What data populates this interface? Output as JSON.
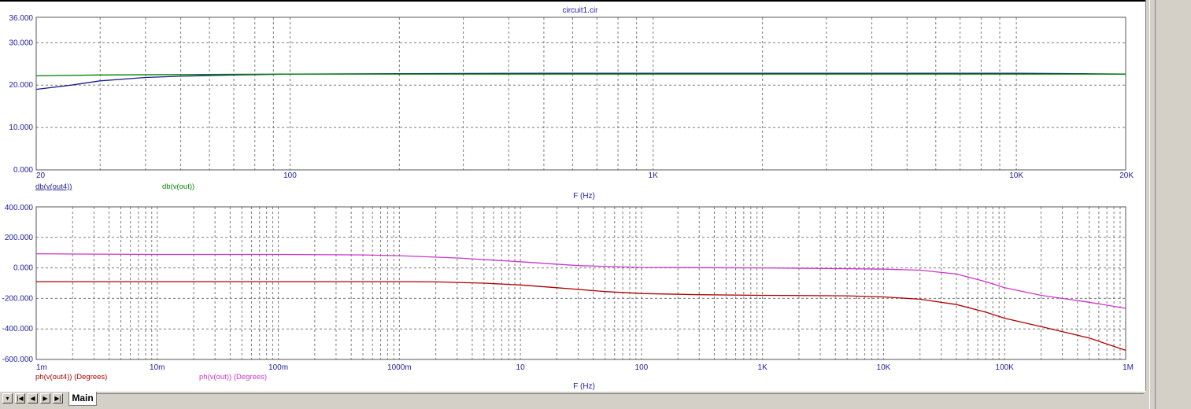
{
  "window_title": "circuit1.cir",
  "colors": {
    "grid": "#7a7a7a",
    "axis_text": "#2020a0",
    "db_out4": "#1c1c8c",
    "db_out": "#008000",
    "ph_out4": "#b00000",
    "ph_out": "#cc33cc"
  },
  "tabbar": {
    "buttons": [
      "chevron-down-icon",
      "first-icon",
      "prev-icon",
      "next-icon",
      "last-icon"
    ],
    "tab_label": "Main"
  },
  "chart_data": [
    {
      "type": "line",
      "xscale": "log",
      "xlim": [
        20,
        20000
      ],
      "ylim": [
        0,
        36
      ],
      "xlabel": "F (Hz)",
      "y_ticks": [
        "36.000",
        "30.000",
        "20.000",
        "10.000",
        "0.000"
      ],
      "y_tick_values": [
        36,
        30,
        20,
        10,
        0
      ],
      "x_tick_labels": [
        "20",
        "100",
        "1K",
        "10K",
        "20K"
      ],
      "x_tick_values": [
        20,
        100,
        1000,
        10000,
        20000
      ],
      "series": [
        {
          "name": "db(v(out4))",
          "x": [
            20,
            25,
            30,
            40,
            50,
            70,
            100,
            200,
            500,
            1000,
            5000,
            10000,
            15000,
            20000
          ],
          "y": [
            19.0,
            20.0,
            21.0,
            21.8,
            22.1,
            22.4,
            22.6,
            22.7,
            22.8,
            22.8,
            22.8,
            22.8,
            22.7,
            22.6
          ]
        },
        {
          "name": "db(v(out))",
          "x": [
            20,
            30,
            50,
            100,
            1000,
            10000,
            20000
          ],
          "y": [
            22.2,
            22.4,
            22.5,
            22.6,
            22.6,
            22.6,
            22.6
          ]
        }
      ]
    },
    {
      "type": "line",
      "xscale": "log",
      "xlim": [
        0.001,
        1000000
      ],
      "ylim": [
        -600,
        400
      ],
      "xlabel": "F (Hz)",
      "y_ticks": [
        "400.000",
        "200.000",
        "0.000",
        "-200.000",
        "-400.000",
        "-600.000"
      ],
      "y_tick_values": [
        400,
        200,
        0,
        -200,
        -400,
        -600
      ],
      "x_tick_labels": [
        "1m",
        "10m",
        "100m",
        "1000m",
        "10",
        "100",
        "1K",
        "10K",
        "100K",
        "1M"
      ],
      "x_tick_values": [
        0.001,
        0.01,
        0.1,
        1,
        10,
        100,
        1000,
        10000,
        100000,
        1000000
      ],
      "series": [
        {
          "name": "ph(v(out4)) (Degrees)",
          "x": [
            0.001,
            0.01,
            0.1,
            1,
            2,
            5,
            10,
            20,
            50,
            100,
            300,
            1000,
            5000,
            10000,
            20000,
            40000,
            70000,
            100000,
            200000,
            500000,
            1000000
          ],
          "y": [
            -90,
            -90,
            -90,
            -90,
            -92,
            -100,
            -112,
            -130,
            -155,
            -168,
            -176,
            -180,
            -183,
            -190,
            -205,
            -240,
            -290,
            -330,
            -385,
            -460,
            -540
          ]
        },
        {
          "name": "ph(v(out)) (Degrees)",
          "x": [
            0.001,
            0.003,
            0.01,
            0.1,
            0.5,
            1,
            3,
            10,
            30,
            100,
            1000,
            5000,
            10000,
            20000,
            40000,
            70000,
            100000,
            200000,
            500000,
            1000000
          ],
          "y": [
            93,
            90,
            88,
            88,
            85,
            80,
            65,
            40,
            15,
            3,
            0,
            -5,
            -8,
            -15,
            -40,
            -90,
            -130,
            -180,
            -225,
            -265
          ]
        }
      ]
    }
  ]
}
